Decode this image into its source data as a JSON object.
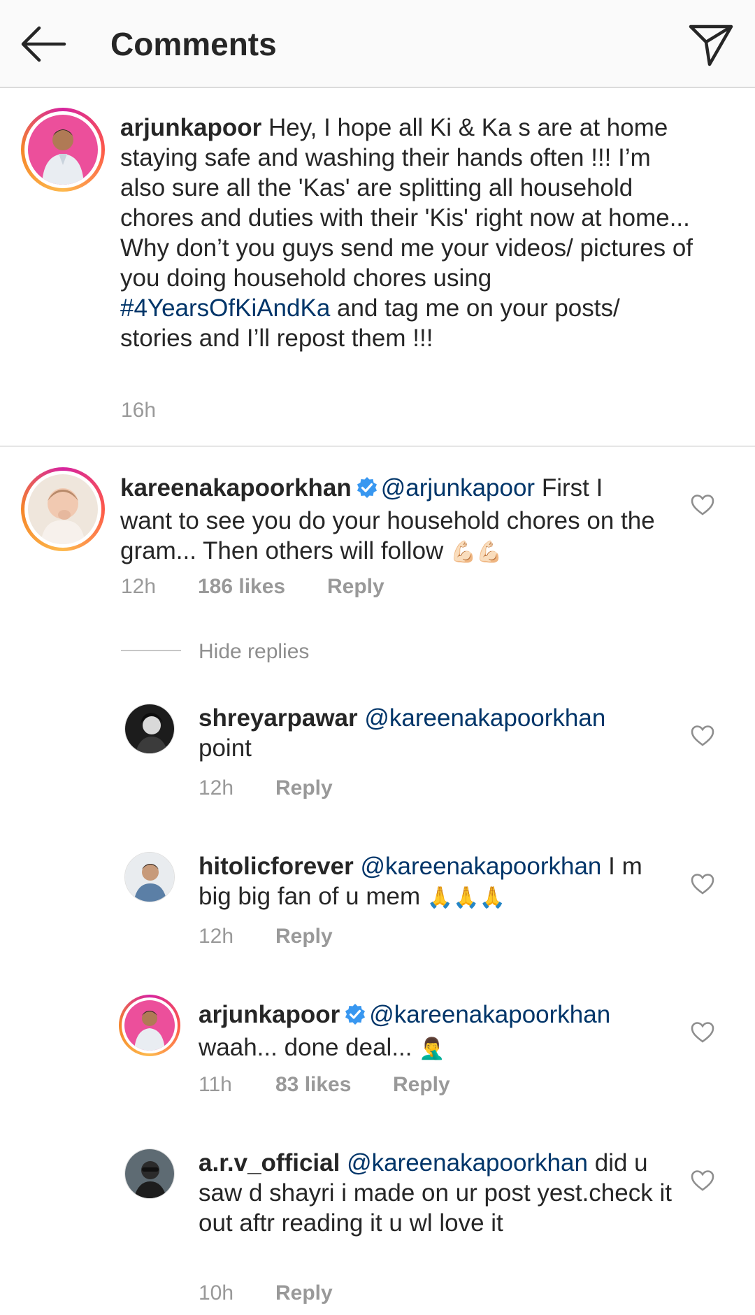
{
  "header": {
    "title": "Comments",
    "back_icon": "arrow-left-icon",
    "share_icon": "paper-plane-icon"
  },
  "caption": {
    "username": "arjunkapoor",
    "text_before_hashtag": "Hey, I hope all Ki & Ka s are at home staying safe and washing their hands often !!! I’m also sure all the 'Kas' are splitting all household chores and duties with their 'Kis' right now at home...",
    "text_line2": "Why don’t you guys send me your videos/ pictures of you doing household chores using ",
    "hashtag": "#4YearsOfKiAndKa",
    "text_after_hashtag": " and tag me on your posts/ stories and I’ll repost them !!!",
    "time": "16h"
  },
  "comments": [
    {
      "username": "kareenakapoorkhan",
      "verified": true,
      "mention": "@arjunkapoor",
      "text": " First I want to see you do your  household chores on the gram... Then others will follow ",
      "emoji": "💪🏻💪🏻",
      "time": "12h",
      "likes": "186 likes",
      "reply": "Reply"
    }
  ],
  "hide_replies": "Hide replies",
  "replies": [
    {
      "username": "shreyarpawar",
      "mention": "@kareenakapoorkhan",
      "text": " point",
      "emoji": "",
      "time": "12h",
      "likes": "",
      "reply": "Reply"
    },
    {
      "username": "hitolicforever",
      "mention": "@kareenakapoorkhan",
      "text": " I m big big fan of u mem ",
      "emoji": "🙏🙏🙏",
      "time": "12h",
      "likes": "",
      "reply": "Reply"
    },
    {
      "username": "arjunkapoor",
      "verified": true,
      "mention": "@kareenakapoorkhan",
      "text": " waah... done deal... ",
      "emoji": "🤦‍♂️",
      "time": "11h",
      "likes": "83 likes",
      "reply": "Reply"
    },
    {
      "username": "a.r.v_official",
      "mention": "@kareenakapoorkhan",
      "text": " did u saw d shayri i made on ur post yest.check it out aftr reading it u wl love it",
      "emoji": "",
      "time": "10h",
      "likes": "",
      "reply": "Reply"
    }
  ],
  "colors": {
    "link": "#003569",
    "meta": "#999999",
    "text": "#262626",
    "header_bg": "#fafafa"
  }
}
